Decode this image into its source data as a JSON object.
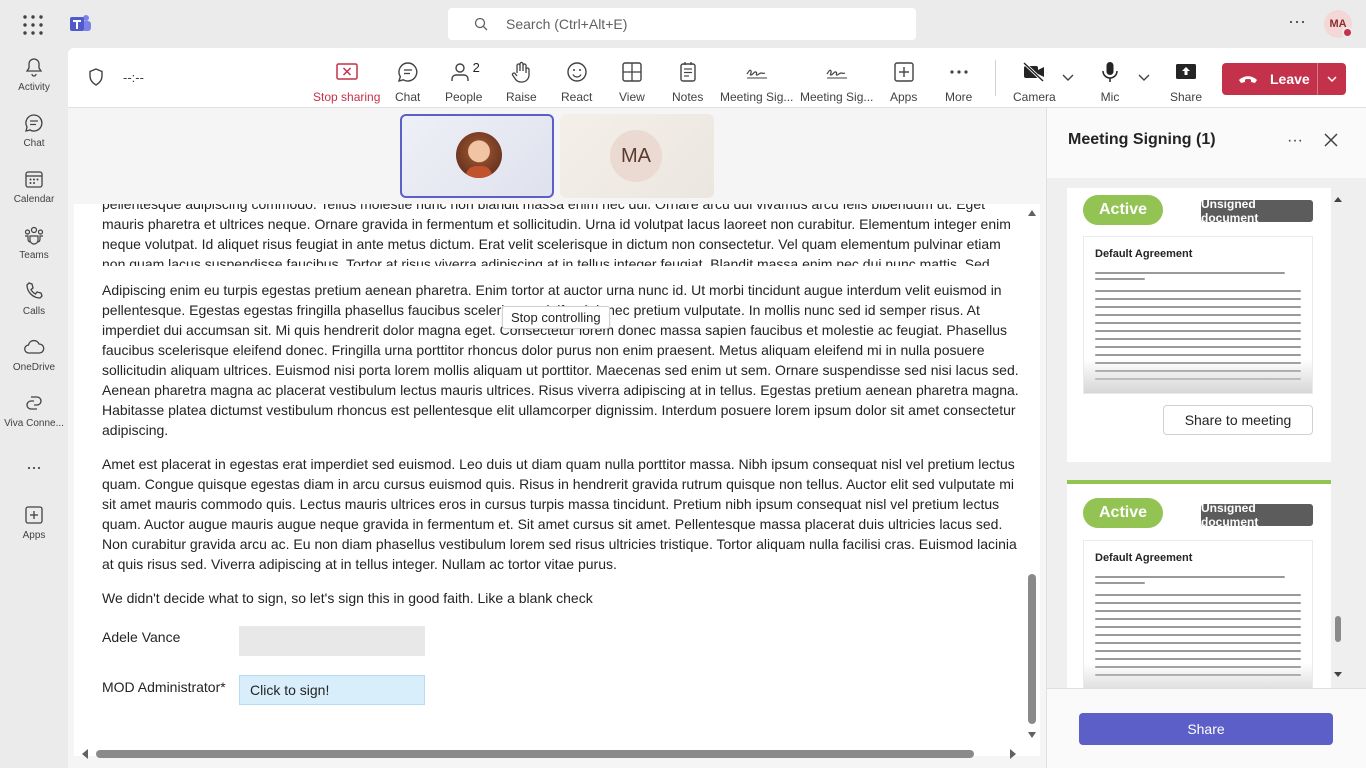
{
  "search": {
    "placeholder": "Search (Ctrl+Alt+E)"
  },
  "user": {
    "initials": "MA"
  },
  "rail": [
    {
      "label": "Activity"
    },
    {
      "label": "Chat"
    },
    {
      "label": "Calendar"
    },
    {
      "label": "Teams"
    },
    {
      "label": "Calls"
    },
    {
      "label": "OneDrive"
    },
    {
      "label": "Viva Conne..."
    },
    {
      "label": "..."
    },
    {
      "label": "Apps"
    }
  ],
  "meeting": {
    "timer": "--:--",
    "tools": {
      "stop_sharing": "Stop sharing",
      "chat": "Chat",
      "people": "People",
      "people_count": "2",
      "raise": "Raise",
      "react": "React",
      "view": "View",
      "notes": "Notes",
      "meeting_sig_1": "Meeting Sig...",
      "meeting_sig_2": "Meeting Sig...",
      "apps": "Apps",
      "more": "More",
      "camera": "Camera",
      "mic": "Mic",
      "share": "Share"
    },
    "leave": "Leave",
    "participant_initials": "MA"
  },
  "document": {
    "stop_controlling": "Stop controlling",
    "paragraphs": [
      "pellentesque adipiscing commodo. Tellus molestie nunc non blandit massa enim nec dui. Ornare arcu dui vivamus arcu felis bibendum ut. Eget mauris pharetra et ultrices neque. Ornare gravida in fermentum et sollicitudin. Urna id volutpat lacus laoreet non curabitur. Elementum integer enim neque volutpat. Id aliquet risus feugiat in ante metus dictum. Erat velit scelerisque in dictum non consectetur. Vel quam elementum pulvinar etiam non quam lacus suspendisse faucibus. Tortor at risus viverra adipiscing at in tellus integer feugiat. Blandit massa enim nec dui nunc mattis. Sed quam adipiscing vitae proin sagittis. Massa id neque aliquam vestibulum morbi blandit cursus. Eu tincidunt tortor aliquam nulla. Fames ac turpis egestas maecenas pharetra convallis. Malesuada pellentesque elit eget gravida cum sociis. Dui nunc mattis enim ut tellus elementum sagittis vitae. Sed tempus urna et pharetra pharetra massa massa.",
      "Adipiscing enim eu turpis egestas pretium aenean pharetra. Enim tortor at auctor urna nunc id. Ut morbi tincidunt augue interdum velit euismod in pellentesque. Egestas egestas fringilla phasellus faucibus scelerisque eleifend donec pretium vulputate. In mollis nunc sed id semper risus. At imperdiet dui accumsan sit. Mi quis hendrerit dolor magna eget. Consectetur lorem donec massa sapien faucibus et molestie ac feugiat. Phasellus faucibus scelerisque eleifend donec. Fringilla urna porttitor rhoncus dolor purus non enim praesent. Metus aliquam eleifend mi in nulla posuere sollicitudin aliquam ultrices. Euismod nisi porta lorem mollis aliquam ut porttitor. Maecenas sed enim ut sem. Ornare suspendisse sed nisi lacus sed. Aenean pharetra magna ac placerat vestibulum lectus mauris ultrices. Risus viverra adipiscing at in tellus. Egestas pretium aenean pharetra magna. Habitasse platea dictumst vestibulum rhoncus est pellentesque elit ullamcorper dignissim. Interdum posuere lorem ipsum dolor sit amet consectetur adipiscing.",
      "Amet est placerat in egestas erat imperdiet sed euismod. Leo duis ut diam quam nulla porttitor massa. Nibh ipsum consequat nisl vel pretium lectus quam. Congue quisque egestas diam in arcu cursus euismod quis. Risus in hendrerit gravida rutrum quisque non tellus. Auctor elit sed vulputate mi sit amet mauris commodo quis. Lectus mauris ultrices eros in cursus turpis massa tincidunt. Pretium nibh ipsum consequat nisl vel pretium lectus quam. Auctor augue mauris augue neque gravida in fermentum et. Sit amet cursus sit amet. Pellentesque massa placerat duis ultricies lacus sed. Non curabitur gravida arcu ac. Eu non diam phasellus vestibulum lorem sed risus ultricies tristique. Tortor aliquam nulla facilisi cras. Euismod lacinia at quis risus sed. Viverra adipiscing at in tellus integer. Nullam ac tortor vitae purus.",
      "We didn't decide what to sign, so let's sign this in good faith. Like a blank check"
    ],
    "signers": [
      {
        "name": "Adele Vance",
        "value": ""
      },
      {
        "name": "MOD Administrator*",
        "value": "Click to sign!"
      }
    ]
  },
  "panel": {
    "title": "Meeting Signing (1)",
    "cards": [
      {
        "status": "Active",
        "badge": "Unsigned document",
        "doc_title": "Default Agreement",
        "action": "Share to meeting"
      },
      {
        "status": "Active",
        "badge": "Unsigned document",
        "doc_title": "Default Agreement"
      }
    ],
    "share": "Share"
  },
  "colors": {
    "accent": "#5b5fc7",
    "leave": "#c4314b",
    "active": "#92c353",
    "badge": "#5c5c5c"
  }
}
